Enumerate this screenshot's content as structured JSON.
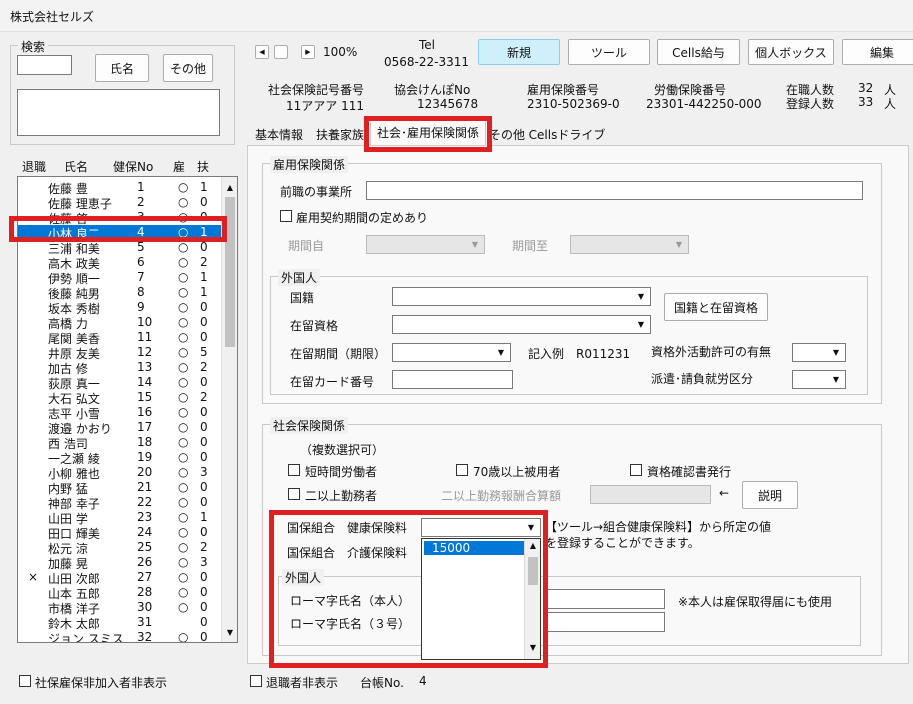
{
  "window": {
    "title": "株式会社セルズ"
  },
  "search": {
    "group_label": "検索",
    "name_button": "氏名",
    "other_button": "その他"
  },
  "list": {
    "headers": {
      "retired": "退職",
      "name": "氏名",
      "no": "健保No",
      "emp": "雇",
      "dep": "扶"
    },
    "rows": [
      {
        "mark": "",
        "name": "佐藤 豊",
        "no": "1",
        "emp": "○",
        "dep": "1"
      },
      {
        "mark": "",
        "name": "佐藤 理恵子",
        "no": "2",
        "emp": "○",
        "dep": "0"
      },
      {
        "mark": "",
        "name": "佐藤 啓",
        "no": "3",
        "emp": "○",
        "dep": "0"
      },
      {
        "mark": "",
        "name": "小林 良二",
        "no": "4",
        "emp": "○",
        "dep": "1"
      },
      {
        "mark": "",
        "name": "三浦 和美",
        "no": "5",
        "emp": "○",
        "dep": "0"
      },
      {
        "mark": "",
        "name": "高木 政美",
        "no": "6",
        "emp": "○",
        "dep": "2"
      },
      {
        "mark": "",
        "name": "伊勢 順一",
        "no": "7",
        "emp": "○",
        "dep": "1"
      },
      {
        "mark": "",
        "name": "後藤 純男",
        "no": "8",
        "emp": "○",
        "dep": "1"
      },
      {
        "mark": "",
        "name": "坂本 秀樹",
        "no": "9",
        "emp": "○",
        "dep": "0"
      },
      {
        "mark": "",
        "name": "高橋 力",
        "no": "10",
        "emp": "○",
        "dep": "0"
      },
      {
        "mark": "",
        "name": "尾関 美香",
        "no": "11",
        "emp": "○",
        "dep": "0"
      },
      {
        "mark": "",
        "name": "井原 友美",
        "no": "12",
        "emp": "○",
        "dep": "5"
      },
      {
        "mark": "",
        "name": "加古 修",
        "no": "13",
        "emp": "○",
        "dep": "2"
      },
      {
        "mark": "",
        "name": "荻原 真一",
        "no": "14",
        "emp": "○",
        "dep": "0"
      },
      {
        "mark": "",
        "name": "大石 弘文",
        "no": "15",
        "emp": "○",
        "dep": "2"
      },
      {
        "mark": "",
        "name": "志平 小雪",
        "no": "16",
        "emp": "○",
        "dep": "0"
      },
      {
        "mark": "",
        "name": "渡邉 かおり",
        "no": "17",
        "emp": "○",
        "dep": "0"
      },
      {
        "mark": "",
        "name": "西 浩司",
        "no": "18",
        "emp": "○",
        "dep": "0"
      },
      {
        "mark": "",
        "name": "一之瀬 綾",
        "no": "19",
        "emp": "○",
        "dep": "0"
      },
      {
        "mark": "",
        "name": "小柳 雅也",
        "no": "20",
        "emp": "○",
        "dep": "3"
      },
      {
        "mark": "",
        "name": "内野 猛",
        "no": "21",
        "emp": "○",
        "dep": "0"
      },
      {
        "mark": "",
        "name": "神部 幸子",
        "no": "22",
        "emp": "○",
        "dep": "0"
      },
      {
        "mark": "",
        "name": "山田 学",
        "no": "23",
        "emp": "○",
        "dep": "1"
      },
      {
        "mark": "",
        "name": "田口 輝美",
        "no": "24",
        "emp": "○",
        "dep": "0"
      },
      {
        "mark": "",
        "name": "松元 涼",
        "no": "25",
        "emp": "○",
        "dep": "2"
      },
      {
        "mark": "",
        "name": "加藤 晃",
        "no": "26",
        "emp": "○",
        "dep": "3"
      },
      {
        "mark": "×",
        "name": "山田 次郎",
        "no": "27",
        "emp": "○",
        "dep": "0"
      },
      {
        "mark": "",
        "name": "山本 五郎",
        "no": "28",
        "emp": "○",
        "dep": "0"
      },
      {
        "mark": "",
        "name": "市橋 洋子",
        "no": "30",
        "emp": "○",
        "dep": "0"
      },
      {
        "mark": "",
        "name": "鈴木 太郎",
        "no": "31",
        "emp": "",
        "dep": "0"
      },
      {
        "mark": "",
        "name": "ジョン スミス",
        "no": "32",
        "emp": "○",
        "dep": "0"
      }
    ],
    "selected_index": 3
  },
  "bottom": {
    "hide_uninsured": "社保雇保非加入者非表示",
    "hide_retired": "退職者非表示",
    "ledger_label": "台帳No.",
    "ledger_value": "4"
  },
  "toolbar": {
    "zoom": "100%",
    "tel_label": "Tel",
    "tel_value": "0568-22-3311",
    "new": "新規",
    "tools": "ツール",
    "cells_pay": "Cells給与",
    "personal_box": "個人ボックス",
    "edit": "編集"
  },
  "info": {
    "shaho_label": "社会保険記号番号",
    "shaho_value": "11アアア 111",
    "kyokai_label": "協会けんぽNo",
    "kyokai_value": "12345678",
    "koyo_label": "雇用保険番号",
    "koyo_value": "2310-502369-0",
    "rodo_label": "労働保険番号",
    "rodo_value": "23301-442250-000",
    "enrolled_label": "在職人数",
    "enrolled_value": "32",
    "registered_label": "登録人数",
    "registered_value": "33",
    "unit": "人"
  },
  "tabs": [
    "基本情報",
    "扶養家族",
    "社会･雇用保険関係",
    "その他",
    "Cellsドライブ"
  ],
  "employment": {
    "group_label": "雇用保険関係",
    "prev_office": "前職の事業所",
    "contract_period": "雇用契約期間の定めあり",
    "period_from": "期間自",
    "period_to": "期間至"
  },
  "foreign": {
    "group_label": "外国人",
    "nationality": "国籍",
    "status": "在留資格",
    "nationality_button": "国籍と在留資格",
    "period": "在留期間（期限）",
    "example": "記入例　R011231",
    "permission": "資格外活動許可の有無",
    "card_no": "在留カード番号",
    "dispatch": "派遣･請負就労区分"
  },
  "social": {
    "group_label": "社会保険関係",
    "multi_note": "（複数選択可）",
    "short_time": "短時間労働者",
    "over70": "70歳以上被用者",
    "cert_issue": "資格確認書発行",
    "two_offices": "二以上勤務者",
    "two_offices_pay": "二以上勤務報酬合算額",
    "arrow": "←",
    "explain_button": "説明",
    "kenpo_label": "国保組合　健康保険料",
    "kaigo_label": "国保組合　介護保険料",
    "note_line1": "【ツール→組合健康保険料】から所定の値",
    "note_line2": "を登録することができます。",
    "dropdown_option": "15000",
    "foreign_group": "外国人",
    "romaji_self": "ローマ字氏名（本人）",
    "romaji_3": "ローマ字氏名（３号）",
    "romaji_note": "※本人は雇保取得届にも使用"
  },
  "colors": {
    "highlight": "#e02020",
    "selection": "#0078d7",
    "accent_button": "#cfeffb"
  }
}
